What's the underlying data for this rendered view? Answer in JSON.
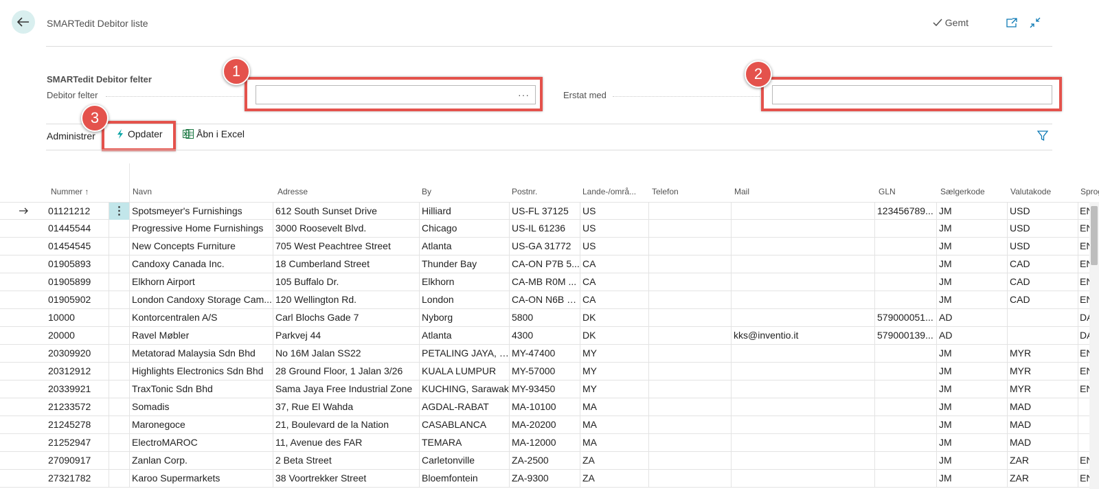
{
  "header": {
    "title": "SMARTedit Debitor liste",
    "saved_label": "Gemt"
  },
  "group": {
    "title": "SMARTedit Debitor felter",
    "debitor_label": "Debitor felter",
    "debitor_value": "",
    "ellipsis": "···",
    "replace_label": "Erstat med",
    "replace_value": ""
  },
  "badges": {
    "b1": "1",
    "b2": "2",
    "b3": "3"
  },
  "actions": {
    "admin": "Administrer",
    "update": "Opdater",
    "excel": "Åbn i Excel"
  },
  "columns": {
    "nummer": "Nummer ↑",
    "navn": "Navn",
    "adresse": "Adresse",
    "by": "By",
    "postnr": "Postnr.",
    "land": "Lande-/områ...",
    "telefon": "Telefon",
    "mail": "Mail",
    "gln": "GLN",
    "saelger": "Sælgerkode",
    "valuta": "Valutakode",
    "sprog": "Sprog"
  },
  "rows": [
    {
      "nummer": "01121212",
      "navn": "Spotsmeyer's Furnishings",
      "adresse": "612 South Sunset Drive",
      "by": "Hilliard",
      "postnr": "US-FL 37125",
      "land": "US",
      "telefon": "",
      "mail": "",
      "gln": "123456789...",
      "saelger": "JM",
      "valuta": "USD",
      "sprog": "EN"
    },
    {
      "nummer": "01445544",
      "navn": "Progressive Home Furnishings",
      "adresse": "3000 Roosevelt Blvd.",
      "by": "Chicago",
      "postnr": "US-IL 61236",
      "land": "US",
      "telefon": "",
      "mail": "",
      "gln": "",
      "saelger": "JM",
      "valuta": "USD",
      "sprog": "EN"
    },
    {
      "nummer": "01454545",
      "navn": "New Concepts Furniture",
      "adresse": "705 West Peachtree Street",
      "by": "Atlanta",
      "postnr": "US-GA 31772",
      "land": "US",
      "telefon": "",
      "mail": "",
      "gln": "",
      "saelger": "JM",
      "valuta": "USD",
      "sprog": "EN"
    },
    {
      "nummer": "01905893",
      "navn": "Candoxy Canada Inc.",
      "adresse": "18 Cumberland Street",
      "by": "Thunder Bay",
      "postnr": "CA-ON P7B 5...",
      "land": "CA",
      "telefon": "",
      "mail": "",
      "gln": "",
      "saelger": "JM",
      "valuta": "CAD",
      "sprog": "EN"
    },
    {
      "nummer": "01905899",
      "navn": "Elkhorn Airport",
      "adresse": "105 Buffalo Dr.",
      "by": "Elkhorn",
      "postnr": "CA-MB R0M ...",
      "land": "CA",
      "telefon": "",
      "mail": "",
      "gln": "",
      "saelger": "JM",
      "valuta": "CAD",
      "sprog": "EN"
    },
    {
      "nummer": "01905902",
      "navn": "London Candoxy Storage Cam...",
      "adresse": "120 Wellington Rd.",
      "by": "London",
      "postnr": "CA-ON N6B 1...",
      "land": "CA",
      "telefon": "",
      "mail": "",
      "gln": "",
      "saelger": "JM",
      "valuta": "CAD",
      "sprog": "EN"
    },
    {
      "nummer": "10000",
      "navn": "Kontorcentralen A/S",
      "adresse": "Carl Blochs Gade 7",
      "by": "Nyborg",
      "postnr": "5800",
      "land": "DK",
      "telefon": "",
      "mail": "",
      "gln": "579000051...",
      "saelger": "AD",
      "valuta": "",
      "sprog": "DA"
    },
    {
      "nummer": "20000",
      "navn": "Ravel Møbler",
      "adresse": "Parkvej 44",
      "by": "Atlanta",
      "postnr": "4300",
      "land": "DK",
      "telefon": "",
      "mail": "kks@inventio.it",
      "gln": "579000139...",
      "saelger": "AD",
      "valuta": "",
      "sprog": "DA"
    },
    {
      "nummer": "20309920",
      "navn": "Metatorad Malaysia Sdn Bhd",
      "adresse": "No 16M Jalan SS22",
      "by": "PETALING JAYA, Se...",
      "postnr": "MY-47400",
      "land": "MY",
      "telefon": "",
      "mail": "",
      "gln": "",
      "saelger": "JM",
      "valuta": "MYR",
      "sprog": "EN"
    },
    {
      "nummer": "20312912",
      "navn": "Highlights Electronics Sdn Bhd",
      "adresse": "28 Ground Floor, 1 Jalan 3/26",
      "by": "KUALA LUMPUR",
      "postnr": "MY-57000",
      "land": "MY",
      "telefon": "",
      "mail": "",
      "gln": "",
      "saelger": "JM",
      "valuta": "MYR",
      "sprog": "EN"
    },
    {
      "nummer": "20339921",
      "navn": "TraxTonic Sdn Bhd",
      "adresse": "Sama Jaya Free Industrial Zone",
      "by": "KUCHING, Sarawak",
      "postnr": "MY-93450",
      "land": "MY",
      "telefon": "",
      "mail": "",
      "gln": "",
      "saelger": "JM",
      "valuta": "MYR",
      "sprog": "EN"
    },
    {
      "nummer": "21233572",
      "navn": "Somadis",
      "adresse": "37, Rue El Wahda",
      "by": "AGDAL-RABAT",
      "postnr": "MA-10100",
      "land": "MA",
      "telefon": "",
      "mail": "",
      "gln": "",
      "saelger": "JM",
      "valuta": "MAD",
      "sprog": ""
    },
    {
      "nummer": "21245278",
      "navn": "Maronegoce",
      "adresse": "21, Boulevard de la Nation",
      "by": "CASABLANCA",
      "postnr": "MA-20200",
      "land": "MA",
      "telefon": "",
      "mail": "",
      "gln": "",
      "saelger": "JM",
      "valuta": "MAD",
      "sprog": ""
    },
    {
      "nummer": "21252947",
      "navn": "ElectroMAROC",
      "adresse": "11, Avenue des FAR",
      "by": "TEMARA",
      "postnr": "MA-12000",
      "land": "MA",
      "telefon": "",
      "mail": "",
      "gln": "",
      "saelger": "JM",
      "valuta": "MAD",
      "sprog": ""
    },
    {
      "nummer": "27090917",
      "navn": "Zanlan Corp.",
      "adresse": "2 Beta Street",
      "by": "Carletonville",
      "postnr": "ZA-2500",
      "land": "ZA",
      "telefon": "",
      "mail": "",
      "gln": "",
      "saelger": "JM",
      "valuta": "ZAR",
      "sprog": "EN"
    },
    {
      "nummer": "27321782",
      "navn": "Karoo Supermarkets",
      "adresse": "38 Voortrekker Street",
      "by": "Bloemfontein",
      "postnr": "ZA-9300",
      "land": "ZA",
      "telefon": "",
      "mail": "",
      "gln": "",
      "saelger": "JM",
      "valuta": "ZAR",
      "sprog": "EN"
    }
  ],
  "colors": {
    "accent": "#00a3a3",
    "highlight": "#e4524c",
    "back_bg": "#d9efef",
    "selected_cell": "#c2e6ea"
  },
  "icons": [
    "back-arrow-icon",
    "checkmark-icon",
    "open-new-window-icon",
    "collapse-icon",
    "lightning-icon",
    "excel-icon",
    "filter-icon",
    "row-arrow-icon",
    "more-menu-icon"
  ]
}
